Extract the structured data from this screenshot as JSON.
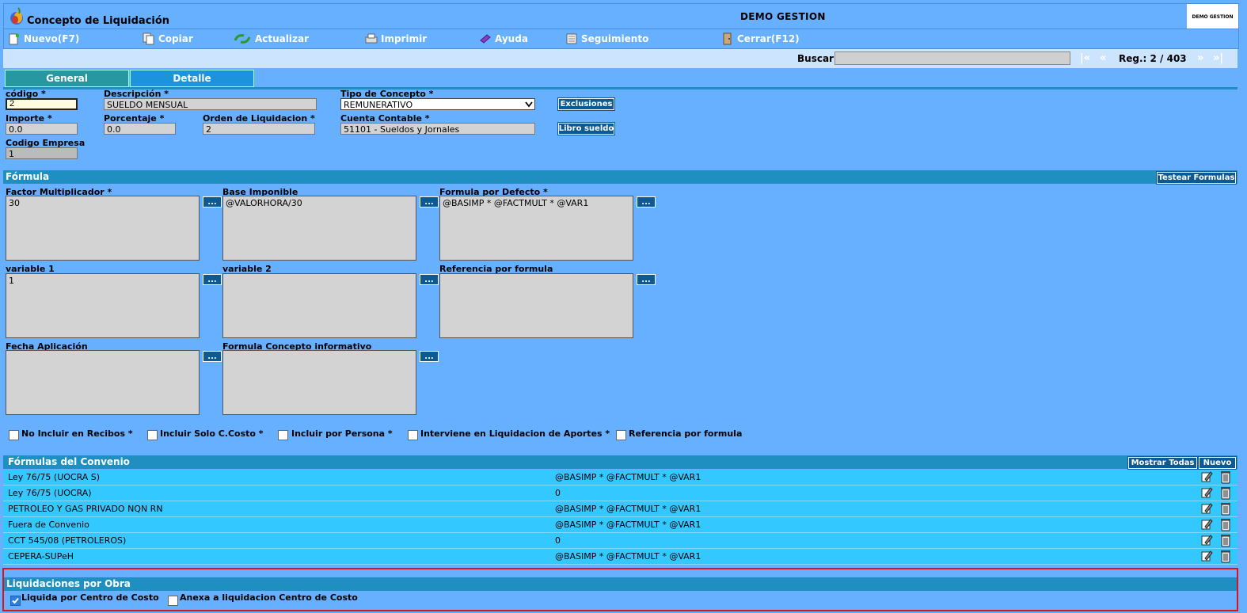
{
  "window": {
    "title": "Concepto de Liquidación",
    "company": "DEMO GESTION",
    "company_logo_text": "DEMO GESTION"
  },
  "toolbar": {
    "items": [
      {
        "label": "Nuevo(F7)",
        "icon": "new-doc-icon"
      },
      {
        "label": "Copiar",
        "icon": "copy-icon"
      },
      {
        "label": "Actualizar",
        "icon": "refresh-icon"
      },
      {
        "label": "Imprimir",
        "icon": "printer-icon"
      },
      {
        "label": "Ayuda",
        "icon": "help-book-icon"
      },
      {
        "label": "Seguimiento",
        "icon": "tracking-icon"
      },
      {
        "label": "Cerrar(F12)",
        "icon": "close-door-icon"
      }
    ]
  },
  "search": {
    "label": "Buscar",
    "value": "",
    "first": "|«",
    "prev": "«",
    "next": "»",
    "last": "»|",
    "reg": "Reg.: 2 / 403"
  },
  "tabs": {
    "general": "General",
    "detalle": "Detalle",
    "active": "General"
  },
  "form": {
    "codigo": {
      "label": "código *",
      "value": "2"
    },
    "descripcion": {
      "label": "Descripción *",
      "value": "SUELDO MENSUAL"
    },
    "tipo_concepto": {
      "label": "Tipo de Concepto *",
      "value": "REMUNERATIVO"
    },
    "exclusiones": "Exclusiones",
    "importe": {
      "label": "Importe *",
      "value": "0.0"
    },
    "porcentaje": {
      "label": "Porcentaje *",
      "value": "0.0"
    },
    "orden": {
      "label": "Orden de Liquidacion *",
      "value": "2"
    },
    "cuenta": {
      "label": "Cuenta Contable *",
      "value": "51101 - Sueldos y Jornales"
    },
    "libro_sueldo": "Libro sueldo",
    "codigo_empresa": {
      "label": "Codigo Empresa",
      "value": "1"
    }
  },
  "formula": {
    "header": "Fórmula",
    "testear": "Testear Formulas",
    "dots": "...",
    "factor": {
      "label": "Factor Multiplicador *",
      "value": "30"
    },
    "base": {
      "label": "Base Imponible",
      "value": "@VALORHORA/30"
    },
    "defecto": {
      "label": "Formula por Defecto *",
      "value": "@BASIMP * @FACTMULT * @VAR1"
    },
    "var1": {
      "label": "variable 1",
      "value": "1"
    },
    "var2": {
      "label": "variable 2",
      "value": ""
    },
    "referencia": {
      "label": "Referencia por formula",
      "value": ""
    },
    "fecha": {
      "label": "Fecha Aplicación",
      "value": ""
    },
    "informativo": {
      "label": "Formula Concepto informativo",
      "value": ""
    }
  },
  "checks": [
    {
      "label": "No Incluir en Recibos *",
      "checked": false
    },
    {
      "label": "Incluir Solo C.Costo *",
      "checked": false
    },
    {
      "label": "Incluir por Persona *",
      "checked": false
    },
    {
      "label": "Interviene en Liquidacion de Aportes *",
      "checked": false
    },
    {
      "label": "Referencia por formula",
      "checked": false
    }
  ],
  "convenio": {
    "header": "Fórmulas del Convenio",
    "mostrar": "Mostrar Todas",
    "nuevo": "Nuevo",
    "rows": [
      {
        "name": "Ley 76/75 (UOCRA S)",
        "formula": "@BASIMP * @FACTMULT * @VAR1"
      },
      {
        "name": "Ley 76/75 (UOCRA)",
        "formula": "0"
      },
      {
        "name": "PETROLEO Y GAS PRIVADO NQN RN",
        "formula": "@BASIMP * @FACTMULT * @VAR1"
      },
      {
        "name": "Fuera de Convenio",
        "formula": "@BASIMP * @FACTMULT * @VAR1"
      },
      {
        "name": "CCT 545/08 (PETROLEROS)",
        "formula": "0"
      },
      {
        "name": "CEPERA-SUPeH",
        "formula": "@BASIMP * @FACTMULT * @VAR1"
      }
    ]
  },
  "obra": {
    "header": "Liquidaciones por Obra",
    "liquida": {
      "label": "Liquida por Centro de Costo",
      "checked": true
    },
    "anexa": {
      "label": "Anexa a liquidacion Centro de Costo",
      "checked": false
    }
  },
  "colors": {
    "background": "#66b0ff",
    "section": "#1e8fc0",
    "row": "#33c8ff",
    "button": "#0b5a94",
    "highlight": "#e0101a"
  }
}
